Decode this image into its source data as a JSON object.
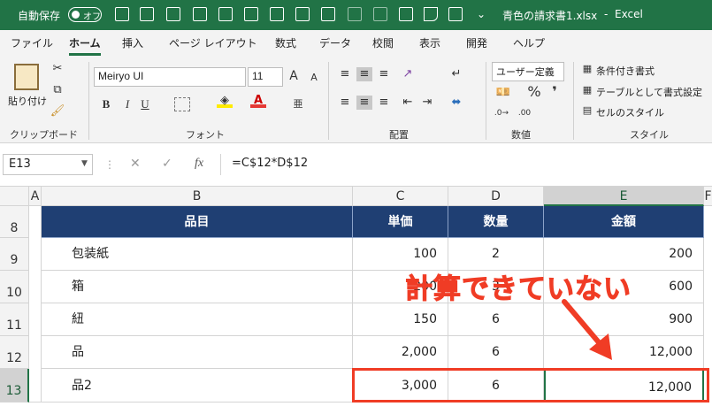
{
  "titlebar": {
    "autosave": "自動保存",
    "toggle": "オフ",
    "filename": "青色の請求書1.xlsx",
    "separator": "-",
    "app": "Excel",
    "overflow_icon": "chevron-down-icon"
  },
  "tabs": [
    "ファイル",
    "ホーム",
    "挿入",
    "ページ レイアウト",
    "数式",
    "データ",
    "校閲",
    "表示",
    "開発",
    "ヘルプ"
  ],
  "ribbon": {
    "clipboard": {
      "paste": "貼り付け",
      "label": "クリップボード"
    },
    "font": {
      "name": "Meiryo UI",
      "size": "11",
      "label": "フォント",
      "grow": "A",
      "shrink": "A",
      "bold": "B",
      "italic": "I",
      "underline": "U",
      "phonetic": "亜"
    },
    "alignment": {
      "label": "配置"
    },
    "number": {
      "format": "ユーザー定義",
      "label": "数値",
      "percent": "%",
      "comma": "❜"
    },
    "styles": {
      "label": "スタイル",
      "conditional": "条件付き書式",
      "table": "テーブルとして書式設定",
      "cell": "セルのスタイル"
    }
  },
  "formula_bar": {
    "name_box": "E13",
    "formula": "=C$12*D$12",
    "fx": "fx",
    "cancel": "✕",
    "enter": "✓",
    "dots": "⋮"
  },
  "grid": {
    "columns": [
      "A",
      "B",
      "C",
      "D",
      "E",
      "F"
    ],
    "rows": [
      "8",
      "9",
      "10",
      "11",
      "12",
      "13"
    ],
    "header": {
      "b": "品目",
      "c": "単価",
      "d": "数量",
      "e": "金額"
    },
    "data": [
      {
        "b": "包装紙",
        "c": "100",
        "d": "2",
        "e": "200"
      },
      {
        "b": "箱",
        "c": "200",
        "d": "3",
        "e": "600"
      },
      {
        "b": "紐",
        "c": "150",
        "d": "6",
        "e": "900"
      },
      {
        "b": "品",
        "c": "2,000",
        "d": "6",
        "e": "12,000"
      },
      {
        "b": "品2",
        "c": "3,000",
        "d": "6",
        "e": "12,000"
      }
    ]
  },
  "annotation": {
    "text": "計算できていない",
    "color": "#f03c25"
  },
  "colors": {
    "excel_green": "#217346",
    "header_fill": "#1f3f73",
    "highlight": "#f03c25"
  }
}
